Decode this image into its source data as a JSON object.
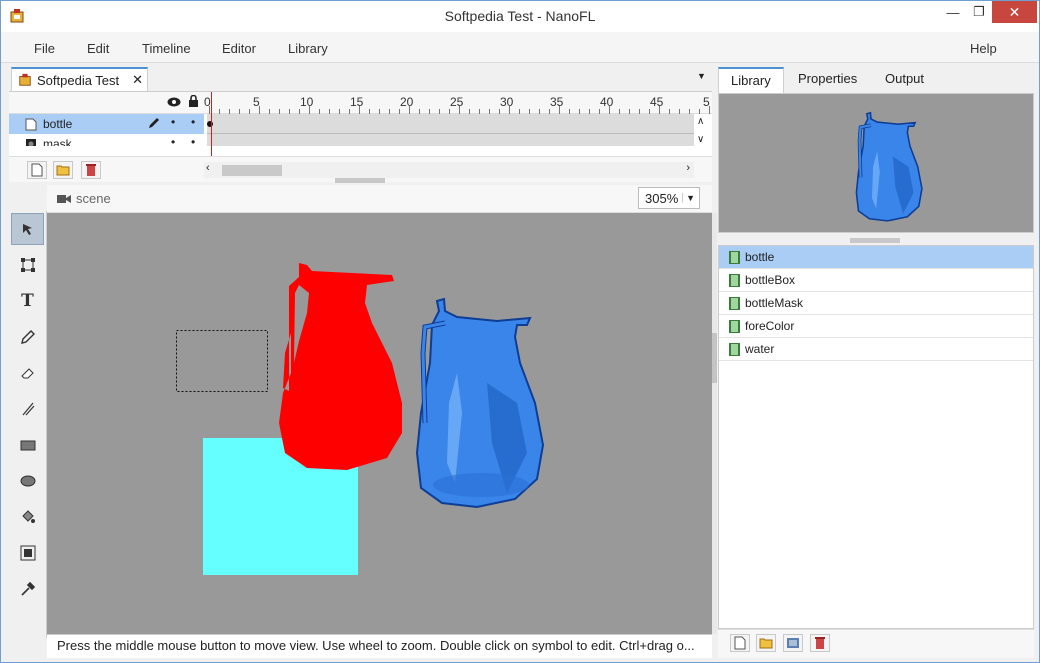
{
  "window": {
    "title": "Softpedia Test - NanoFL"
  },
  "menu": {
    "items": [
      "File",
      "Edit",
      "Timeline",
      "Editor",
      "Library"
    ],
    "help": "Help"
  },
  "document_tab": {
    "label": "Softpedia Test",
    "close": "✕"
  },
  "timeline": {
    "ruler": [
      "0",
      "5",
      "10",
      "15",
      "20",
      "25",
      "30",
      "35",
      "40",
      "45",
      "5"
    ],
    "layers": [
      {
        "name": "bottle",
        "selected": true
      },
      {
        "name": "mask",
        "selected": false
      }
    ]
  },
  "stage": {
    "scene_label": "scene",
    "zoom": "305%"
  },
  "status": {
    "text": "Press the middle mouse button to move view. Use wheel to zoom. Double click on symbol to edit. Ctrl+drag o..."
  },
  "right_tabs": [
    "Library",
    "Properties",
    "Output"
  ],
  "library": {
    "items": [
      {
        "name": "bottle",
        "selected": true
      },
      {
        "name": "bottleBox",
        "selected": false
      },
      {
        "name": "bottleMask",
        "selected": false
      },
      {
        "name": "foreColor",
        "selected": false
      },
      {
        "name": "water",
        "selected": false
      }
    ]
  },
  "colors": {
    "accent": "#4a8fd0",
    "jug_red": "#ff0000",
    "jug_blue": "#2f7fe0",
    "box_cyan": "#66ffff",
    "canvas": "#999999"
  }
}
